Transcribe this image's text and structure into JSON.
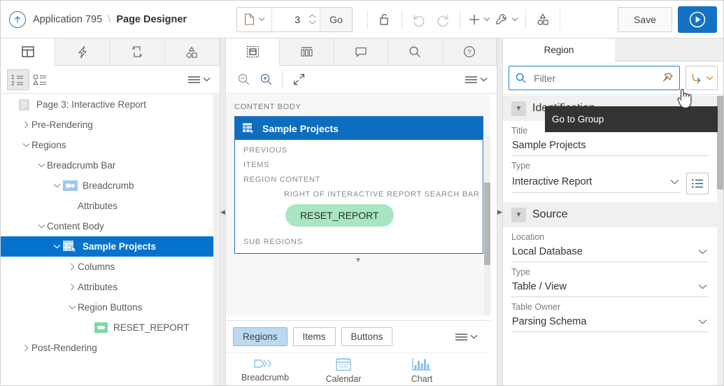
{
  "header": {
    "up_icon": "arrow-up-circle-icon",
    "app_name": "Application 795",
    "separator": "\\",
    "title": "Page Designer",
    "page_type_icon": "page-icon",
    "page_number": "3",
    "go_label": "Go",
    "tools": [
      {
        "name": "lock-icon",
        "label": "Lock"
      },
      {
        "name": "undo-icon",
        "label": "Undo"
      },
      {
        "name": "redo-icon",
        "label": "Redo"
      },
      {
        "name": "add-icon",
        "label": "Create"
      },
      {
        "name": "wrench-icon",
        "label": "Utilities"
      },
      {
        "name": "shapes-icon",
        "label": "Shared Components"
      }
    ],
    "save_label": "Save",
    "run_icon": "play-circle-icon"
  },
  "left_panel": {
    "tabs": [
      {
        "name": "rendering",
        "icon": "grid-layout-icon",
        "active": true
      },
      {
        "name": "dynamic-actions",
        "icon": "lightning-icon",
        "active": false
      },
      {
        "name": "processing",
        "icon": "process-loop-icon",
        "active": false
      },
      {
        "name": "shared-components",
        "icon": "shapes-icon",
        "active": false
      }
    ],
    "toolbar": {
      "expand_icon": "numbered-list-icon",
      "collapse_icon": "shapes-list-icon",
      "menu_icon": "hamburger-caret-icon"
    },
    "tree": [
      {
        "label": "Page 3: Interactive Report",
        "indent": 0,
        "twisty": "",
        "icon": "page-icon",
        "selected": false
      },
      {
        "label": "Pre-Rendering",
        "indent": 1,
        "twisty": "collapsed",
        "icon": "",
        "selected": false
      },
      {
        "label": "Regions",
        "indent": 1,
        "twisty": "expanded",
        "icon": "",
        "selected": false
      },
      {
        "label": "Breadcrumb Bar",
        "indent": 2,
        "twisty": "expanded",
        "icon": "",
        "selected": false
      },
      {
        "label": "Breadcrumb",
        "indent": 3,
        "twisty": "expanded",
        "icon": "breadcrumb-icon",
        "selected": false
      },
      {
        "label": "Attributes",
        "indent": 4,
        "twisty": "",
        "icon": "",
        "selected": false
      },
      {
        "label": "Content Body",
        "indent": 2,
        "twisty": "expanded",
        "icon": "",
        "selected": false
      },
      {
        "label": "Sample Projects",
        "indent": 3,
        "twisty": "expanded",
        "icon": "interactive-report-icon",
        "selected": true
      },
      {
        "label": "Columns",
        "indent": 4,
        "twisty": "collapsed",
        "icon": "",
        "selected": false
      },
      {
        "label": "Attributes",
        "indent": 4,
        "twisty": "collapsed",
        "icon": "",
        "selected": false
      },
      {
        "label": "Region Buttons",
        "indent": 4,
        "twisty": "expanded",
        "icon": "",
        "selected": false
      },
      {
        "label": "RESET_REPORT",
        "indent": 5,
        "twisty": "",
        "icon": "button-icon",
        "selected": false
      },
      {
        "label": "Post-Rendering",
        "indent": 1,
        "twisty": "collapsed",
        "icon": "",
        "selected": false
      }
    ]
  },
  "center_panel": {
    "tabs": [
      {
        "name": "layout",
        "icon": "layout-icon",
        "active": true
      },
      {
        "name": "page-search",
        "icon": "columns-icon",
        "active": false
      },
      {
        "name": "messages",
        "icon": "comment-icon",
        "active": false
      },
      {
        "name": "search",
        "icon": "magnifier-icon",
        "active": false
      },
      {
        "name": "help",
        "icon": "help-circle-icon",
        "active": false
      }
    ],
    "toolbar": {
      "zoom_out_icon": "zoom-out-icon",
      "zoom_in_icon": "zoom-in-icon",
      "expand_icon": "expand-arrows-icon",
      "menu_icon": "hamburger-caret-icon"
    },
    "layout": {
      "grid_label": "CONTENT BODY",
      "region_title": "Sample Projects",
      "region_icon": "interactive-report-icon",
      "slots": [
        {
          "label": "PREVIOUS",
          "indent": false
        },
        {
          "label": "ITEMS",
          "indent": false
        },
        {
          "label": "REGION CONTENT",
          "indent": false
        },
        {
          "label": "RIGHT OF INTERACTIVE REPORT SEARCH BAR",
          "indent": true
        }
      ],
      "button_chip": "RESET_REPORT",
      "sub_regions_label": "SUB REGIONS"
    },
    "gallery_tabs": [
      {
        "label": "Regions",
        "active": true
      },
      {
        "label": "Items",
        "active": false
      },
      {
        "label": "Buttons",
        "active": false
      }
    ],
    "gallery_menu_icon": "hamburger-caret-icon",
    "gallery_items": [
      {
        "label": "Breadcrumb",
        "icon": "breadcrumb-icon"
      },
      {
        "label": "Calendar",
        "icon": "calendar-icon"
      },
      {
        "label": "Chart",
        "icon": "chart-icon"
      }
    ]
  },
  "right_panel": {
    "tabs": [
      {
        "label": "Region",
        "active": true
      }
    ],
    "filter": {
      "icon": "search-icon",
      "placeholder": "Filter",
      "value": "",
      "pin_icon": "pin-icon"
    },
    "goto_group": {
      "icon": "goto-arrow-icon",
      "caret": "chevron-down-icon"
    },
    "tooltip": "Go to Group",
    "groups": [
      {
        "title": "Identification",
        "fields": [
          {
            "label": "Title",
            "value": "Sample Projects",
            "control": "text"
          },
          {
            "label": "Type",
            "value": "Interactive Report",
            "control": "select",
            "lov_icon": "list-icon"
          }
        ]
      },
      {
        "title": "Source",
        "fields": [
          {
            "label": "Location",
            "value": "Local Database",
            "control": "select"
          },
          {
            "label": "Type",
            "value": "Table / View",
            "control": "select"
          },
          {
            "label": "Table Owner",
            "value": "Parsing Schema",
            "control": "select"
          }
        ]
      }
    ]
  },
  "colors": {
    "accent": "#1471c4",
    "selection": "#0572ce",
    "region_header": "#0d6ebf",
    "button_chip": "#a8e6c3",
    "tooltip_bg": "#333333",
    "active_tab_bg": "#bcd9f2"
  }
}
